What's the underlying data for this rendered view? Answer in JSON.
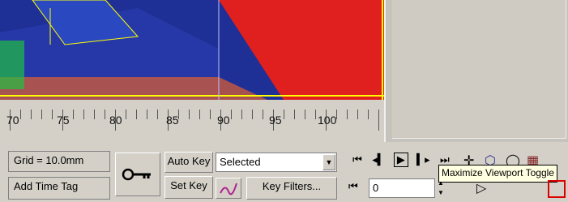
{
  "ruler": {
    "ticks": [
      "70",
      "75",
      "80",
      "85",
      "90",
      "95",
      "100"
    ]
  },
  "status": {
    "grid": "Grid = 10.0mm",
    "time_tag": "Add Time Tag"
  },
  "keys": {
    "auto_key": "Auto Key",
    "set_key": "Set Key",
    "selection_set": "Selected",
    "key_filters": "Key Filters..."
  },
  "playback": {
    "current_frame": "0"
  },
  "tooltip": "Maximize Viewport Toggle",
  "icons": {
    "transport": [
      "go-to-start-icon",
      "previous-frame-icon",
      "play-icon",
      "next-frame-icon",
      "go-to-end-icon"
    ],
    "nav": [
      "zoom-icon",
      "zoom-all-icon",
      "orbit-icon",
      "pan-icon",
      "field-of-view-icon",
      "maximize-viewport-icon"
    ]
  },
  "colors": {
    "viewport_bg": "#1e2f96",
    "highlight": "#ffff00",
    "object": "#e0201e",
    "tooltip_bg": "#ffffe1"
  }
}
